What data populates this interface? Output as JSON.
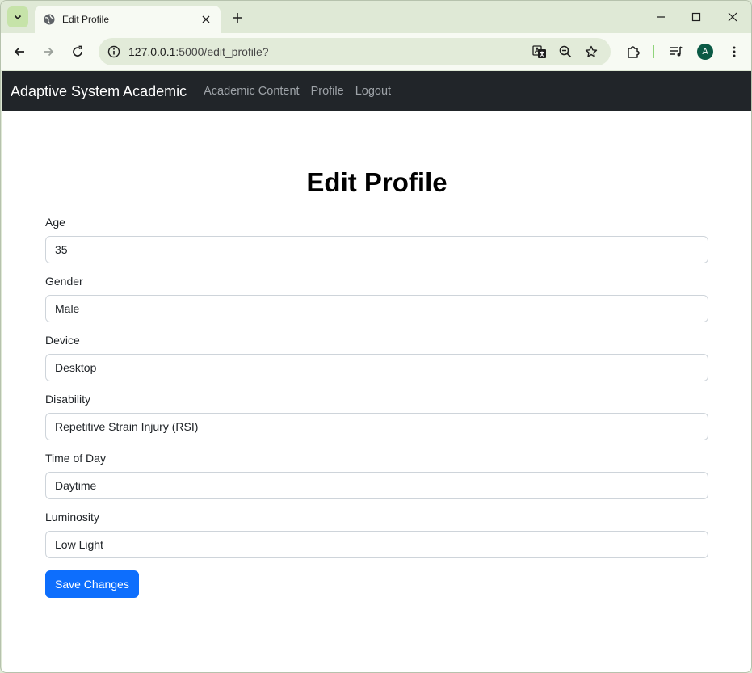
{
  "browser": {
    "tab_title": "Edit Profile",
    "url_host": "127.0.0.1",
    "url_rest": ":5000/edit_profile?",
    "avatar_initial": "A",
    "icons": {
      "tab_search": "chevron-down-icon",
      "favicon": "globe-icon",
      "close": "close-icon",
      "new_tab": "plus-icon",
      "back": "arrow-left-icon",
      "forward": "arrow-right-icon",
      "reload": "reload-icon",
      "site_info": "info-icon",
      "translate": "translate-icon",
      "zoom": "zoom-out-icon",
      "bookmark": "star-icon",
      "extensions": "puzzle-icon",
      "media": "media-queue-icon",
      "menu": "more-vertical-icon"
    }
  },
  "navbar": {
    "brand": "Adaptive System Academic",
    "links": [
      "Academic Content",
      "Profile",
      "Logout"
    ],
    "bg_color": "#212529"
  },
  "form": {
    "title": "Edit Profile",
    "fields": [
      {
        "label": "Age",
        "value": "35"
      },
      {
        "label": "Gender",
        "value": "Male"
      },
      {
        "label": "Device",
        "value": "Desktop"
      },
      {
        "label": "Disability",
        "value": "Repetitive Strain Injury (RSI)"
      },
      {
        "label": "Time of Day",
        "value": "Daytime"
      },
      {
        "label": "Luminosity",
        "value": "Low Light"
      }
    ],
    "submit_label": "Save Changes",
    "submit_color": "#0d6efd"
  }
}
